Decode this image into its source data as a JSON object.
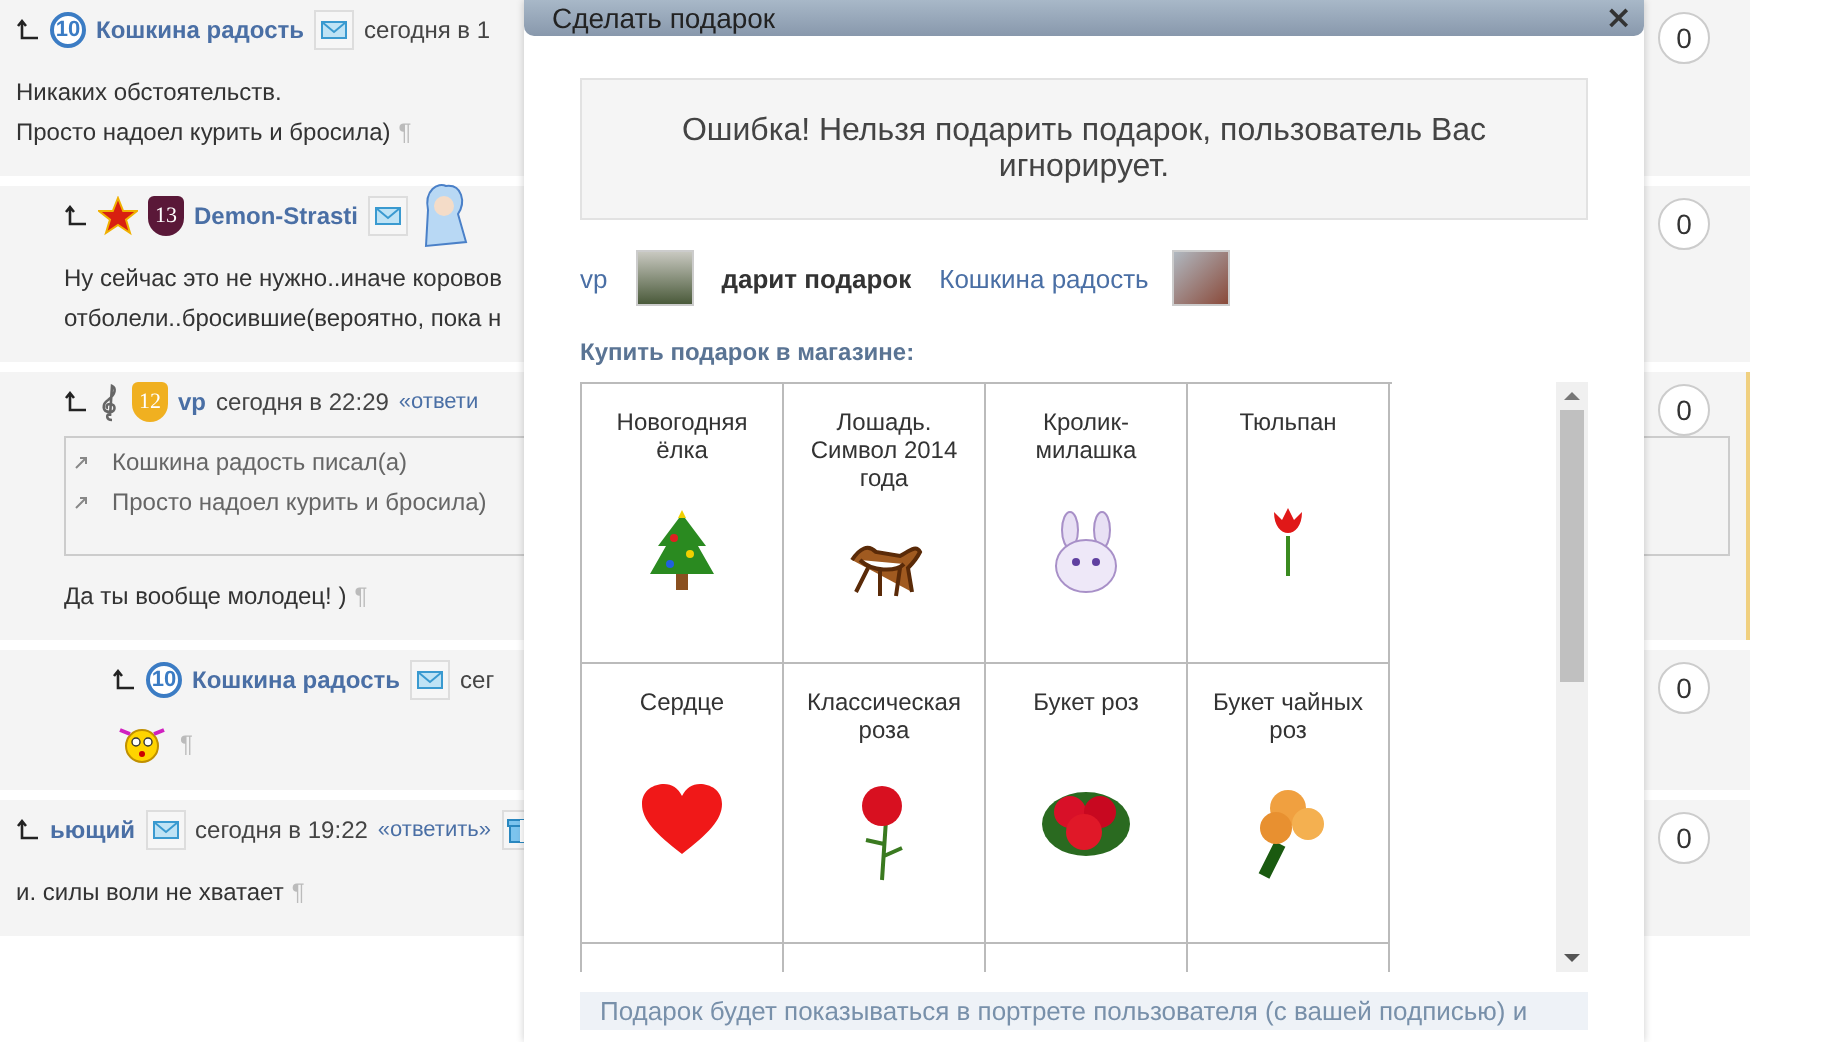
{
  "comments": [
    {
      "header": [
        {
          "kind": "round_badge",
          "label": "10",
          "color": "#3b7cc4"
        }
      ],
      "author": "Кошкина радость",
      "mail": true,
      "time": "сегодня в 1",
      "lines": [
        "Никаких обстоятельств.",
        "Просто надоел курить и бросила)"
      ],
      "pilcrow": "¶",
      "counter": "0",
      "highlighted": false,
      "children": [
        {
          "header": [
            {
              "kind": "star"
            },
            {
              "kind": "shield_badge",
              "label": "13",
              "color": "#5a1838"
            }
          ],
          "author": "Demon-Strasti",
          "mail": true,
          "avatar": true,
          "lines": [
            "Ну сейчас это не нужно..иначе коровов",
            "отболели..бросившие(вероятно, пока н"
          ],
          "counter": "0",
          "highlighted": false
        },
        {
          "header": [
            {
              "kind": "clef"
            },
            {
              "kind": "shield_badge",
              "label": "12",
              "color": "#f0b020"
            }
          ],
          "author": "vp",
          "time": "сегодня в 22:29",
          "reply": "«ответи",
          "quote": [
            "Кошкина радость писал(а)",
            "Просто надоел курить и бросила)"
          ],
          "lines": [
            "Да ты вообще молодец! )"
          ],
          "pilcrow": "¶",
          "counter": "0",
          "highlighted": true,
          "children": [
            {
              "header": [
                {
                  "kind": "round_badge",
                  "label": "10",
                  "color": "#3b7cc4"
                }
              ],
              "author": "Кошкина радость",
              "mail": true,
              "time": "сег",
              "smiley": true,
              "pilcrow": "¶",
              "counter": "0",
              "highlighted": false
            }
          ]
        }
      ]
    },
    {
      "author": "ьющий",
      "mail": true,
      "time": "сегодня в 19:22",
      "reply": "«ответить»",
      "gift": true,
      "lines": [
        "и. силы воли не хватает"
      ],
      "pilcrow": "¶",
      "counter": "0",
      "highlighted": false
    }
  ],
  "modal": {
    "title": "Сделать подарок",
    "close": "×",
    "error": "Ошибка! Нельзя подарить подарок, пользователь Вас игнорирует.",
    "giver": "vp",
    "action": "дарит подарок",
    "recipient": "Кошкина радость",
    "shop_title": "Купить подарок в магазине:",
    "gifts": [
      {
        "name": "Новогодняя ёлка",
        "kind": "tree"
      },
      {
        "name": "Лошадь. Символ 2014 года",
        "kind": "horse"
      },
      {
        "name": "Кролик-милашка",
        "kind": "bunny"
      },
      {
        "name": "Тюльпан",
        "kind": "tulip"
      },
      {
        "name": "Сердце",
        "kind": "heart"
      },
      {
        "name": "Классическая роза",
        "kind": "rose"
      },
      {
        "name": "Букет роз",
        "kind": "roses"
      },
      {
        "name": "Букет чайных роз",
        "kind": "tea_roses"
      }
    ],
    "note": "Подарок будет показываться в портрете пользователя (с вашей подписью) и"
  }
}
